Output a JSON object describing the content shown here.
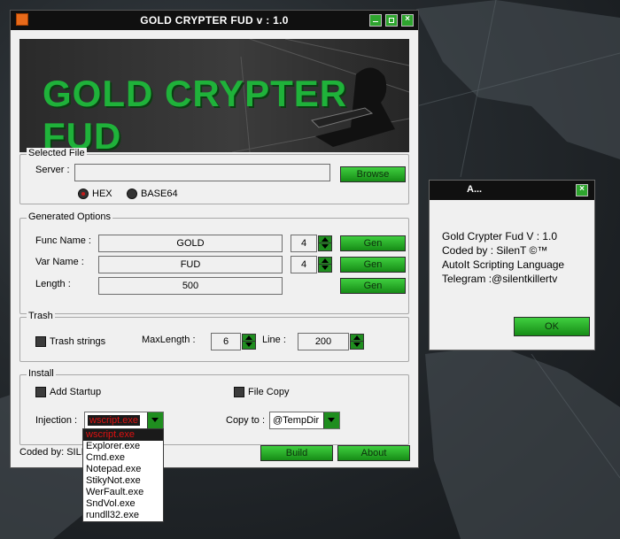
{
  "main_window": {
    "title": "GOLD CRYPTER FUD v : 1.0",
    "banner_text": "GOLD CRYPTER FUD",
    "selected_file": {
      "group_label": "Selected File",
      "server_label": "Server :",
      "server_value": "",
      "browse_label": "Browse",
      "radio_hex": "HEX",
      "radio_base64": "BASE64",
      "selected_encoding": "HEX"
    },
    "generated_options": {
      "group_label": "Generated Options",
      "func_label": "Func Name :",
      "func_value": "GOLD",
      "func_len": "4",
      "var_label": "Var Name :",
      "var_value": "FUD",
      "var_len": "4",
      "length_label": "Length :",
      "length_value": "500",
      "gen_label": "Gen"
    },
    "trash": {
      "group_label": "Trash",
      "trash_strings_label": "Trash strings",
      "trash_strings_checked": false,
      "maxlength_label": "MaxLength :",
      "maxlength_value": "6",
      "line_label": "Line :",
      "line_value": "200"
    },
    "install": {
      "group_label": "Install",
      "add_startup_label": "Add Startup",
      "add_startup_checked": false,
      "file_copy_label": "File Copy",
      "file_copy_checked": false,
      "injection_label": "Injection :",
      "injection_value": "wscript.exe",
      "injection_options": [
        "wscript.exe",
        "Explorer.exe",
        "Cmd.exe",
        "Notepad.exe",
        "StikyNot.exe",
        "WerFault.exe",
        "SndVol.exe",
        "rundll32.exe"
      ],
      "copy_to_label": "Copy to :",
      "copy_to_value": "@TempDir"
    },
    "footer": {
      "coded_by": "Coded by: SILE",
      "build_label": "Build",
      "about_label": "About"
    }
  },
  "about_dialog": {
    "title": "A...",
    "lines": [
      "Gold Crypter Fud V : 1.0",
      "Coded by : SilenT ©™",
      "AutoIt Scripting Language",
      "Telegram :@silentkillertv"
    ],
    "ok_label": "OK"
  },
  "colors": {
    "accent_green": "#1fb23a",
    "button_green": "#2a9e2a",
    "title_bar": "#101010",
    "selected_text_red": "#d11111"
  }
}
